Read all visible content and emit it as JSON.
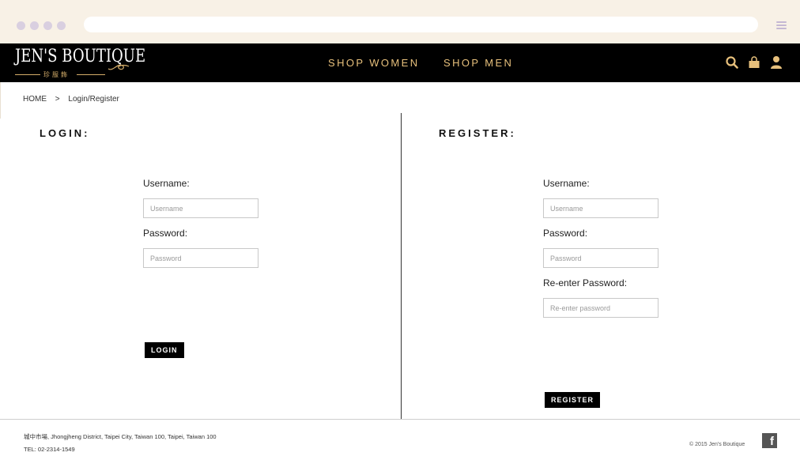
{
  "browser": {
    "menu_icon": "hamburger-icon"
  },
  "header": {
    "logo_text": "JEN'S BOUTIQUE",
    "logo_subtext": "珍服飾",
    "nav": [
      {
        "label": "SHOP WOMEN"
      },
      {
        "label": "SHOP MEN"
      }
    ],
    "icons": [
      "search-icon",
      "shopping-bag-icon",
      "user-icon"
    ],
    "accent_color": "#e7c07c",
    "background_color": "#000000"
  },
  "breadcrumb": {
    "home": "HOME",
    "separator": ">",
    "current": "Login/Register"
  },
  "login": {
    "title": "LOGIN:",
    "username_label": "Username:",
    "username_placeholder": "Username",
    "password_label": "Password:",
    "password_placeholder": "Password",
    "button_label": "LOGIN"
  },
  "register": {
    "title": "REGISTER:",
    "username_label": "Username:",
    "username_placeholder": "Username",
    "password_label": "Password:",
    "password_placeholder": "Password",
    "reenter_label": "Re-enter Password:",
    "reenter_placeholder": "Re-enter password",
    "button_label": "REGISTER"
  },
  "footer": {
    "address": "城中市場, Jhongjheng District, Taipei City, Taiwan 100, Taipei, Taiwan 100",
    "tel": "TEL: 02-2314-1549",
    "copyright": "© 2015 Jen's Boutique",
    "social_icon": "facebook-icon",
    "social_glyph": "f"
  }
}
